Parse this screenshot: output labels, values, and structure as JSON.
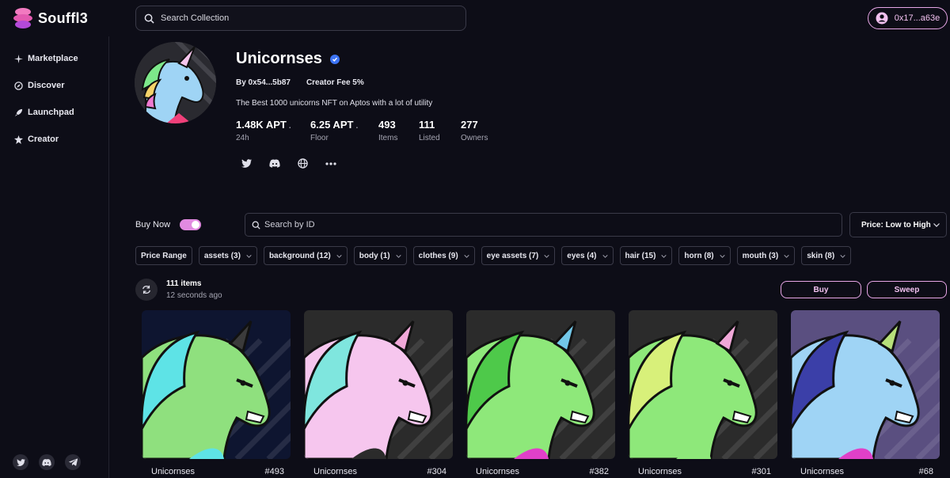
{
  "app": {
    "name": "Souffl3"
  },
  "search": {
    "placeholder": "Search Collection"
  },
  "wallet": {
    "address": "0x17...a63e"
  },
  "sidebar": {
    "items": [
      {
        "label": "Marketplace",
        "icon": "sparkle-icon"
      },
      {
        "label": "Discover",
        "icon": "compass-icon"
      },
      {
        "label": "Launchpad",
        "icon": "rocket-icon"
      },
      {
        "label": "Creator",
        "icon": "creator-icon"
      }
    ],
    "socials": [
      "twitter-icon",
      "discord-icon",
      "telegram-icon"
    ]
  },
  "collection": {
    "name": "Unicornses",
    "verified": true,
    "creator": "By 0x54...5b87",
    "creator_fee": "Creator Fee 5%",
    "description": "The Best 1000 unicorns NFT on Aptos with a lot of utility",
    "stats": [
      {
        "value": "1.48K APT",
        "label": "24h",
        "dot": "."
      },
      {
        "value": "6.25 APT",
        "label": "Floor",
        "dot": "."
      },
      {
        "value": "493",
        "label": "Items",
        "dot": ""
      },
      {
        "value": "111",
        "label": "Listed",
        "dot": ""
      },
      {
        "value": "277",
        "label": "Owners",
        "dot": ""
      }
    ],
    "links": [
      "twitter-icon",
      "discord-icon",
      "globe-icon",
      "more-icon"
    ]
  },
  "toolbar": {
    "buy_now_label": "Buy Now",
    "buy_now_on": true,
    "search_id_placeholder": "Search by ID",
    "sort_label": "Price: Low to High"
  },
  "filters": [
    {
      "label": "Price Range",
      "dropdown": false
    },
    {
      "label": "assets (3)",
      "dropdown": true
    },
    {
      "label": "background (12)",
      "dropdown": true
    },
    {
      "label": "body (1)",
      "dropdown": true
    },
    {
      "label": "clothes (9)",
      "dropdown": true
    },
    {
      "label": "eye assets (7)",
      "dropdown": true
    },
    {
      "label": "eyes (4)",
      "dropdown": true
    },
    {
      "label": "hair (15)",
      "dropdown": true
    },
    {
      "label": "horn (8)",
      "dropdown": true
    },
    {
      "label": "mouth (3)",
      "dropdown": true
    },
    {
      "label": "skin (8)",
      "dropdown": true
    }
  ],
  "results": {
    "count": "111 items",
    "updated": "12 seconds ago",
    "buy_label": "Buy",
    "sweep_label": "Sweep"
  },
  "nfts": [
    {
      "name": "Unicornses",
      "id": "#493",
      "bg": "#0e1530",
      "head": "#8fe07e",
      "mane": "#5ee3e6",
      "horn": "#3b3b3b",
      "shirt": "#5ee3e6"
    },
    {
      "name": "Unicornses",
      "id": "#304",
      "bg": "#2b2b2b",
      "head": "#f6c6ee",
      "mane": "#7fe6de",
      "horn": "#f0a8d8",
      "shirt": "#2b2b2b"
    },
    {
      "name": "Unicornses",
      "id": "#382",
      "bg": "#2b2b2b",
      "head": "#8ee87a",
      "mane": "#4ec94a",
      "horn": "#72c7e8",
      "shirt": "#e040c8"
    },
    {
      "name": "Unicornses",
      "id": "#301",
      "bg": "#2b2b2b",
      "head": "#8ee87a",
      "mane": "#d8f07a",
      "horn": "#f0a8d8",
      "shirt": "#8ee87a"
    },
    {
      "name": "Unicornses",
      "id": "#68",
      "bg": "#5a4f80",
      "head": "#9fd4f5",
      "mane": "#3b3fa8",
      "horn": "#b7e07a",
      "shirt": "#e040c8"
    }
  ]
}
